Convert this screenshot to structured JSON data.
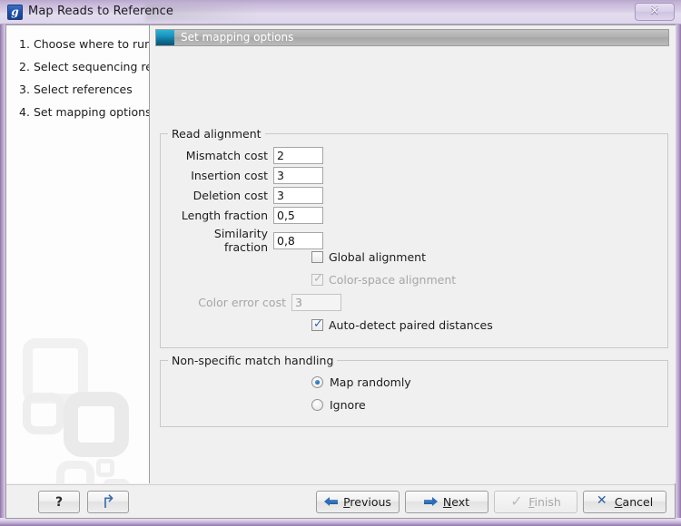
{
  "window": {
    "title": "Map Reads to Reference",
    "app_icon": "g",
    "close_label": "✕"
  },
  "sidebar": {
    "steps": [
      {
        "num": "1.",
        "label": "Choose where to run"
      },
      {
        "num": "2.",
        "label": "Select sequencing reads"
      },
      {
        "num": "3.",
        "label": "Select references"
      },
      {
        "num": "4.",
        "label": "Set mapping options"
      }
    ]
  },
  "content": {
    "header_title": "Set mapping options",
    "read_alignment": {
      "legend": "Read alignment",
      "fields": [
        {
          "label": "Mismatch cost",
          "value": "2",
          "enabled": true
        },
        {
          "label": "Insertion cost",
          "value": "3",
          "enabled": true
        },
        {
          "label": "Deletion cost",
          "value": "3",
          "enabled": true
        },
        {
          "label": "Length fraction",
          "value": "0,5",
          "enabled": true
        },
        {
          "label": "Similarity fraction",
          "value": "0,8",
          "enabled": true
        }
      ],
      "global_alignment": {
        "label": "Global alignment",
        "checked": false,
        "enabled": true
      },
      "color_space_alignment": {
        "label": "Color-space alignment",
        "checked": true,
        "enabled": false
      },
      "color_error_cost": {
        "label": "Color error cost",
        "value": "3",
        "enabled": false
      },
      "auto_detect": {
        "label": "Auto-detect paired distances",
        "checked": true,
        "enabled": true
      }
    },
    "non_specific": {
      "legend": "Non-specific match handling",
      "options": [
        {
          "label": "Map randomly",
          "selected": true
        },
        {
          "label": "Ignore",
          "selected": false
        }
      ]
    }
  },
  "buttons": {
    "help": "?",
    "reset_icon": "undo-arrow-icon",
    "previous": {
      "pre": "",
      "mnemonic": "P",
      "post": "revious",
      "enabled": true
    },
    "next": {
      "pre": "",
      "mnemonic": "N",
      "post": "ext",
      "enabled": true
    },
    "finish": {
      "pre": "",
      "mnemonic": "F",
      "post": "inish",
      "enabled": false
    },
    "cancel": {
      "pre": "",
      "mnemonic": "C",
      "post": "ancel",
      "enabled": true
    }
  },
  "colors": {
    "titlebar": "#d8cce5",
    "header_accent": "#1a93bd",
    "check_blue": "#2a62b8",
    "radio_blue": "#1c62b0"
  }
}
